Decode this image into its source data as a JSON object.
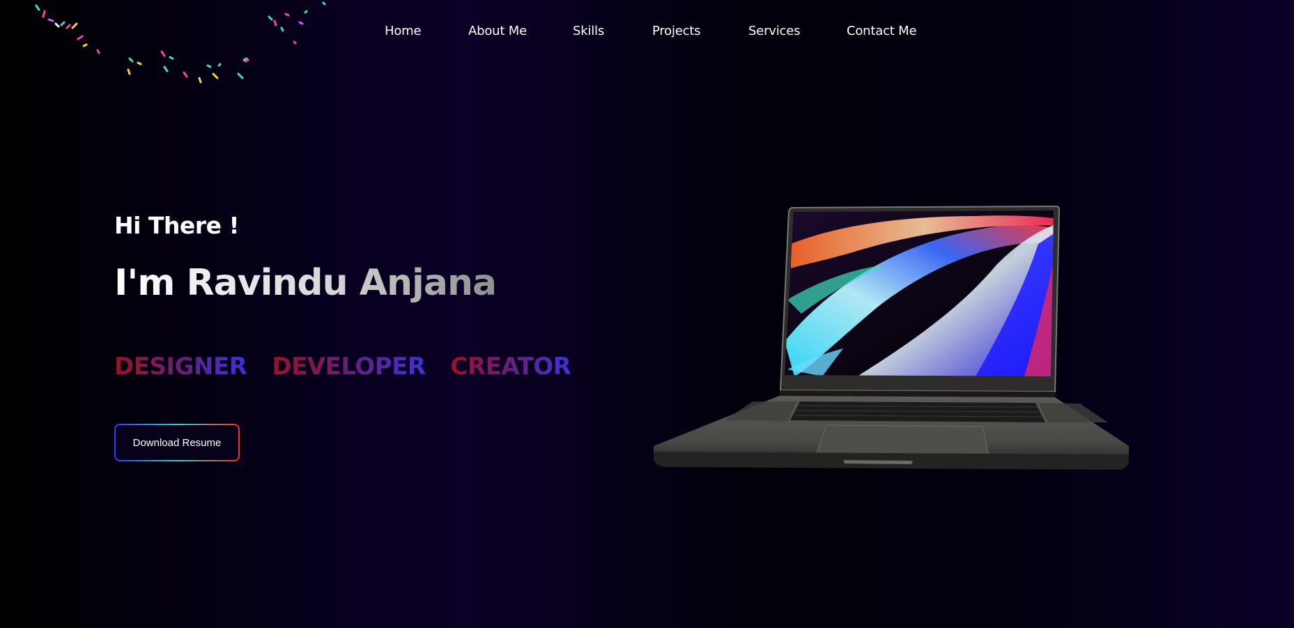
{
  "nav": {
    "items": [
      {
        "label": "Home"
      },
      {
        "label": "About Me"
      },
      {
        "label": "Skills"
      },
      {
        "label": "Projects"
      },
      {
        "label": "Services"
      },
      {
        "label": "Contact Me"
      }
    ]
  },
  "hero": {
    "greeting": "Hi There !",
    "name": "I'm Ravindu Anjana",
    "roles": [
      "DESIGNER",
      "DEVELOPER",
      "CREATOR"
    ],
    "resume_button": "Download Resume"
  },
  "colors": {
    "background": "#0b0026",
    "role_gradient_start": "#9a1226",
    "role_gradient_end": "#3b33d6",
    "button_border_start": "#3b35ff",
    "button_border_mid": "#28d6c9",
    "button_border_end": "#ff2a2a"
  },
  "icons": {
    "decoration": "confetti-particles",
    "hero_image": "laptop-illustration"
  }
}
